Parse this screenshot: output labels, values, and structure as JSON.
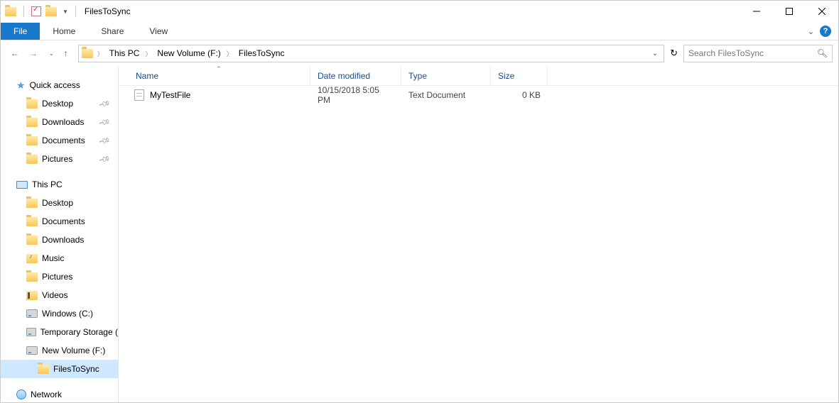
{
  "window": {
    "title": "FilesToSync"
  },
  "ribbon": {
    "file": "File",
    "tabs": [
      "Home",
      "Share",
      "View"
    ]
  },
  "breadcrumb": {
    "items": [
      "This PC",
      "New Volume (F:)",
      "FilesToSync"
    ]
  },
  "search": {
    "placeholder": "Search FilesToSync"
  },
  "navpane": {
    "quick_access": {
      "label": "Quick access",
      "items": [
        {
          "label": "Desktop",
          "pinned": true
        },
        {
          "label": "Downloads",
          "pinned": true
        },
        {
          "label": "Documents",
          "pinned": true
        },
        {
          "label": "Pictures",
          "pinned": true
        }
      ]
    },
    "this_pc": {
      "label": "This PC",
      "items": [
        {
          "label": "Desktop",
          "icon": "folder"
        },
        {
          "label": "Documents",
          "icon": "folder"
        },
        {
          "label": "Downloads",
          "icon": "folder"
        },
        {
          "label": "Music",
          "icon": "music"
        },
        {
          "label": "Pictures",
          "icon": "folder"
        },
        {
          "label": "Videos",
          "icon": "video"
        },
        {
          "label": "Windows (C:)",
          "icon": "drive"
        },
        {
          "label": "Temporary Storage (",
          "icon": "drive"
        },
        {
          "label": "New Volume (F:)",
          "icon": "drive",
          "children": [
            {
              "label": "FilesToSync",
              "selected": true
            }
          ]
        }
      ]
    },
    "network": {
      "label": "Network"
    }
  },
  "columns": {
    "name": "Name",
    "date": "Date modified",
    "type": "Type",
    "size": "Size"
  },
  "files": [
    {
      "name": "MyTestFile",
      "date": "10/15/2018 5:05 PM",
      "type": "Text Document",
      "size": "0 KB"
    }
  ]
}
